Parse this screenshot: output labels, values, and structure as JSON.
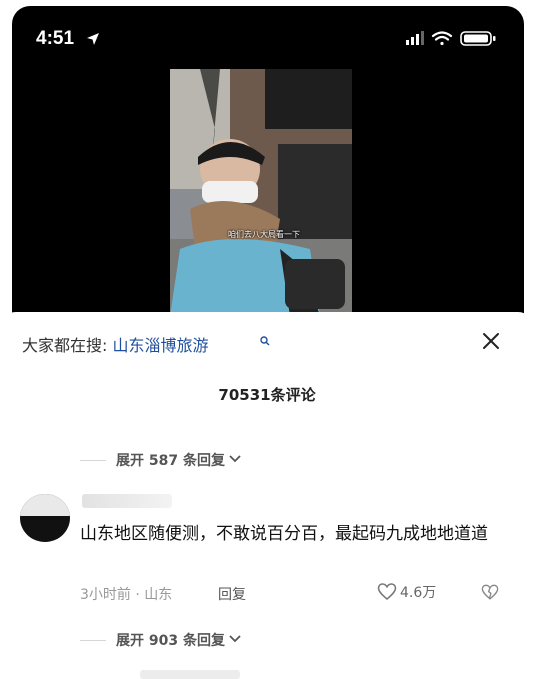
{
  "status_bar": {
    "time": "4:51"
  },
  "video": {
    "caption": "咱们去八大局看一下"
  },
  "comments_sheet": {
    "search_prefix": "大家都在搜: ",
    "search_term": "山东淄博旅游",
    "comment_count": "70531条评论",
    "expand_1": "展开 587 条回复",
    "comment": {
      "text": "山东地区随便测，不敢说百分百，最起码九成地地道道",
      "time_location": "3小时前 · 山东",
      "reply_label": "回复",
      "likes": "4.6万"
    },
    "expand_2": "展开 903 条回复"
  },
  "colors": {
    "link": "#1f4f9c",
    "sheet_bg": "#ffffff",
    "video_bg": "#000000"
  }
}
